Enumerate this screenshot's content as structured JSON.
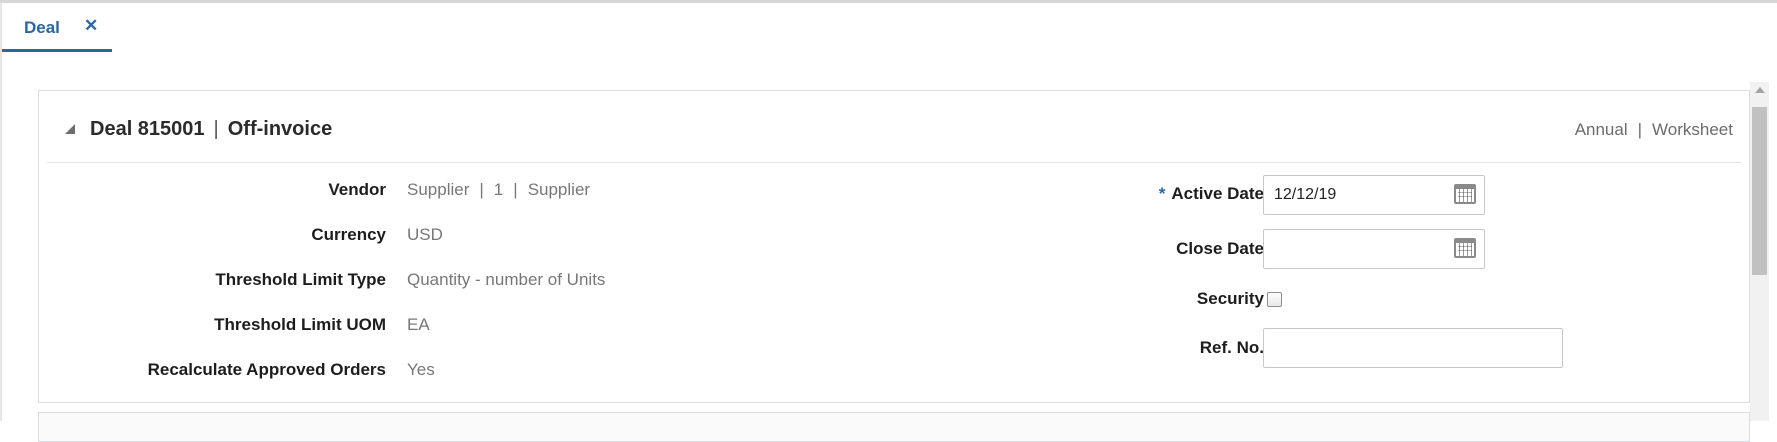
{
  "tabs": [
    {
      "label": "Deal",
      "close": "✕"
    }
  ],
  "header": {
    "deal_label": "Deal 815001",
    "separator": "|",
    "deal_type": "Off-invoice",
    "link_annual": "Annual",
    "link_separator": "|",
    "link_worksheet": "Worksheet"
  },
  "fields_left": [
    {
      "label": "Vendor",
      "value_parts": [
        "Supplier",
        "1",
        "Supplier"
      ],
      "separator": "|"
    },
    {
      "label": "Currency",
      "value": "USD"
    },
    {
      "label": "Threshold Limit Type",
      "value": "Quantity - number of Units"
    },
    {
      "label": "Threshold Limit UOM",
      "value": "EA"
    },
    {
      "label": "Recalculate Approved Orders",
      "value": "Yes"
    }
  ],
  "fields_right": {
    "active_date": {
      "required_marker": "*",
      "label": "Active Date",
      "value": "12/12/19",
      "icon": "calendar-icon"
    },
    "close_date": {
      "label": "Close Date",
      "value": "",
      "icon": "calendar-icon"
    },
    "security": {
      "label": "Security",
      "checked": false
    },
    "ref_no": {
      "label": "Ref. No.",
      "value": ""
    }
  },
  "colors": {
    "accent": "#2a67a3",
    "label": "#1d1d1d",
    "value": "#777777",
    "border": "#d8dde3"
  }
}
